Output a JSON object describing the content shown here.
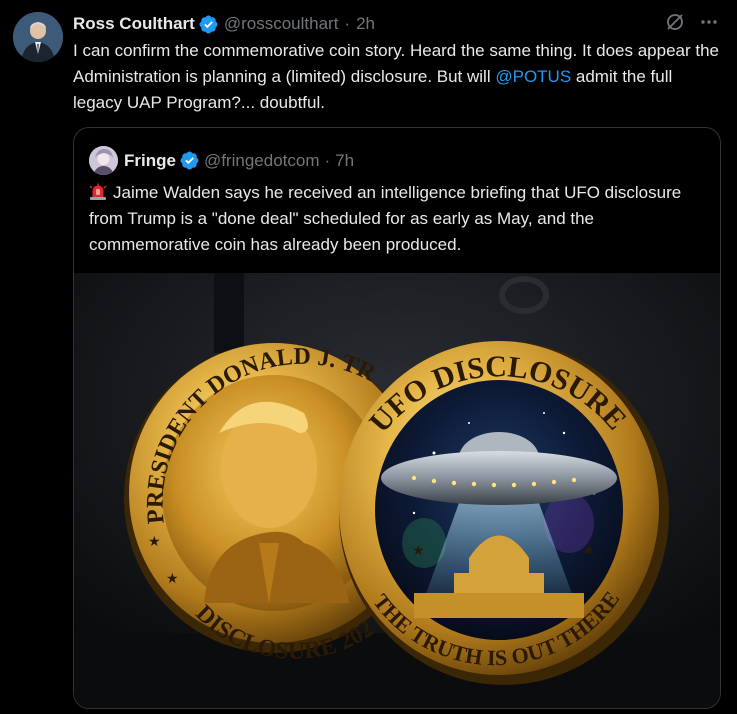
{
  "tweet": {
    "author_name": "Ross Coulthart",
    "author_handle": "@rosscoulthart",
    "separator": "·",
    "time": "2h",
    "text_1": "I can confirm the commemorative coin story.  Heard the same thing. It does appear the Administration is planning a (limited) disclosure. But will ",
    "mention": "@POTUS",
    "text_2": " admit the full legacy UAP Program?... doubtful."
  },
  "quote": {
    "author_name": "Fringe",
    "author_handle": "@fringedotcom",
    "separator": "·",
    "time": "7h",
    "siren_icon": "police-light-emoji",
    "text": "Jaime Walden says he received an intelligence briefing that UFO disclosure from Trump is a \"done deal\" scheduled for as early as May, and the commemorative coin has already been produced."
  },
  "image": {
    "left_coin_text_top": "PRESIDENT DONALD J. TR",
    "left_coin_text_bottom": "DISCLOSURE 202",
    "right_coin_text_top": "UFO DISCLOSURE",
    "right_coin_text_bottom": "THE TRUTH IS OUT THERE"
  },
  "colors": {
    "background": "#000000",
    "text": "#e7e9ea",
    "muted": "#71767b",
    "accent": "#1d9bf0",
    "border": "#2f3336",
    "gold": "#d4a23a"
  }
}
